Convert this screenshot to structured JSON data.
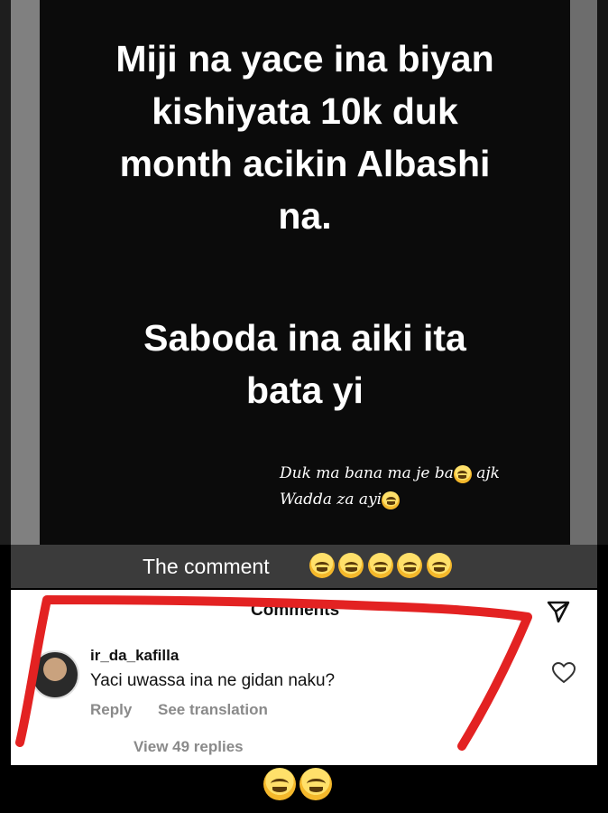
{
  "story": {
    "headline_lines": [
      "Miji na yace ina biyan",
      "kishiyata 10k duk",
      "month acikin Albashi",
      "na."
    ],
    "headline2_lines": [
      "Saboda ina aiki ita",
      "bata yi"
    ],
    "small_line1": "Duk ma bana ma je ba",
    "small_line1_after": " ajk",
    "small_line2": "Wadda za ayi"
  },
  "caption": {
    "text": "The comment"
  },
  "comments": {
    "title": "Comments",
    "items": [
      {
        "username": "ir_da_kafilla",
        "text": "Yaci uwassa ina ne gidan naku?",
        "reply_label": "Reply",
        "translation_label": "See translation",
        "view_replies": "View 49 replies"
      }
    ]
  },
  "colors": {
    "annotation": "#e32222",
    "caption_bar": "#3b3b3b"
  },
  "icons": [
    "send-icon",
    "heart-icon",
    "laughing-emoji",
    "kiss-emoji",
    "shushing-emoji"
  ]
}
